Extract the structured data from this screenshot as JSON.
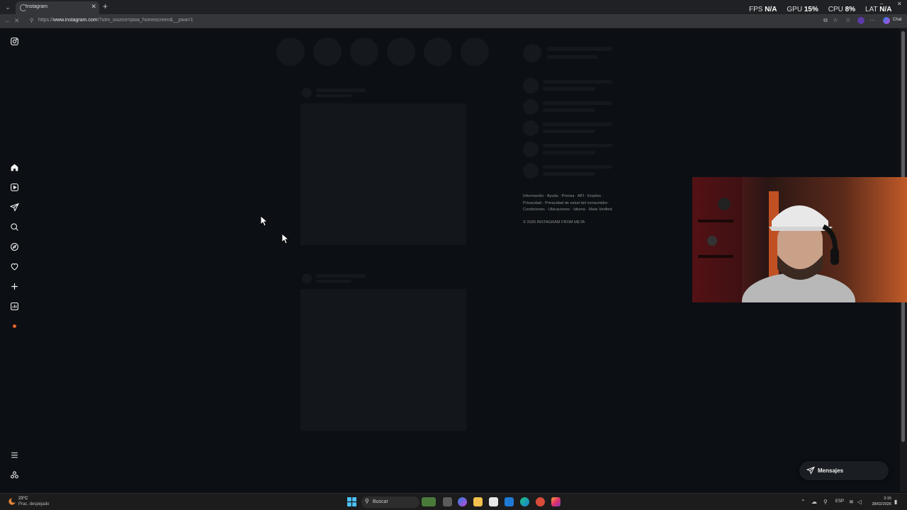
{
  "browser": {
    "tab_title": "Instagram",
    "url_scheme": "https://",
    "url_host": "www.instagram.com",
    "url_path": "/?utm_source=pwa_homescreen&__pwa=1",
    "chat_label": "Chat"
  },
  "perf": {
    "fps_label": "FPS",
    "fps_value": "N/A",
    "gpu_label": "GPU",
    "gpu_value": "15",
    "cpu_label": "CPU",
    "cpu_value": "8",
    "lat_label": "LAT",
    "lat_value": "N/A",
    "unit": "%"
  },
  "sidebar": {
    "items": [
      "instagram-logo",
      "home",
      "reels",
      "messages",
      "search",
      "explore",
      "notifications",
      "create",
      "dashboard",
      "profile",
      "more",
      "also-from-meta"
    ]
  },
  "footer": {
    "line1": "Información · Ayuda · Prensa · API · Empleo ·",
    "line2": "Privacidad · Privacidad de salud del consumidor ·",
    "line3": "Condiciones · Ubicaciones · Idioma · Meta Verified",
    "copyright": "© 2026 INSTAGRAM FROM META"
  },
  "messages_button": {
    "label": "Mensajes"
  },
  "taskbar": {
    "weather_temp": "23°C",
    "weather_desc": "Prac. despejado",
    "search_label": "Buscar",
    "lang": "ESP",
    "time": "3:15",
    "date": "28/02/2026"
  },
  "colors": {
    "page_bg": "#0c0f14",
    "skeleton": "#15181d",
    "accent_red": "#ff3040"
  }
}
